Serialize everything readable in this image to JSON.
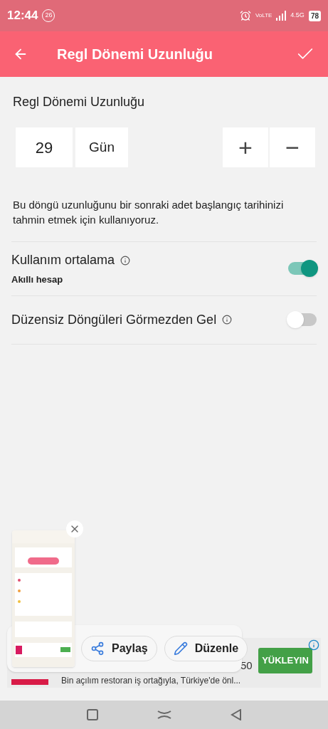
{
  "status_bar": {
    "time": "12:44",
    "badge": "26",
    "volte": "VoLTE",
    "network": "4.5G",
    "battery": "78"
  },
  "app_bar": {
    "title": "Regl Dönemi Uzunluğu"
  },
  "section_title": "Regl Dönemi Uzunluğu",
  "stepper": {
    "value": "29",
    "unit": "Gün",
    "plus": "+",
    "minus": "−"
  },
  "description": "Bu döngü uzunluğunu bir sonraki adet başlangıç tarihinizi tahmin etmek için kullanıyoruz.",
  "settings": [
    {
      "label": "Kullanım ortalama",
      "subtitle": "Akıllı hesap",
      "on": true
    },
    {
      "label": "Düzensiz Döngüleri Görmezden Gel",
      "on": false
    }
  ],
  "ad": {
    "number": "50",
    "text": "Bin açılım restoran iş ortağıyla, Türkiye'de önl...",
    "button": "YÜKLEYIN"
  },
  "screenshot_toolbar": {
    "actions": [
      {
        "kind": "share",
        "label": "Paylaş"
      },
      {
        "kind": "edit",
        "label": "Düzenle"
      }
    ]
  }
}
